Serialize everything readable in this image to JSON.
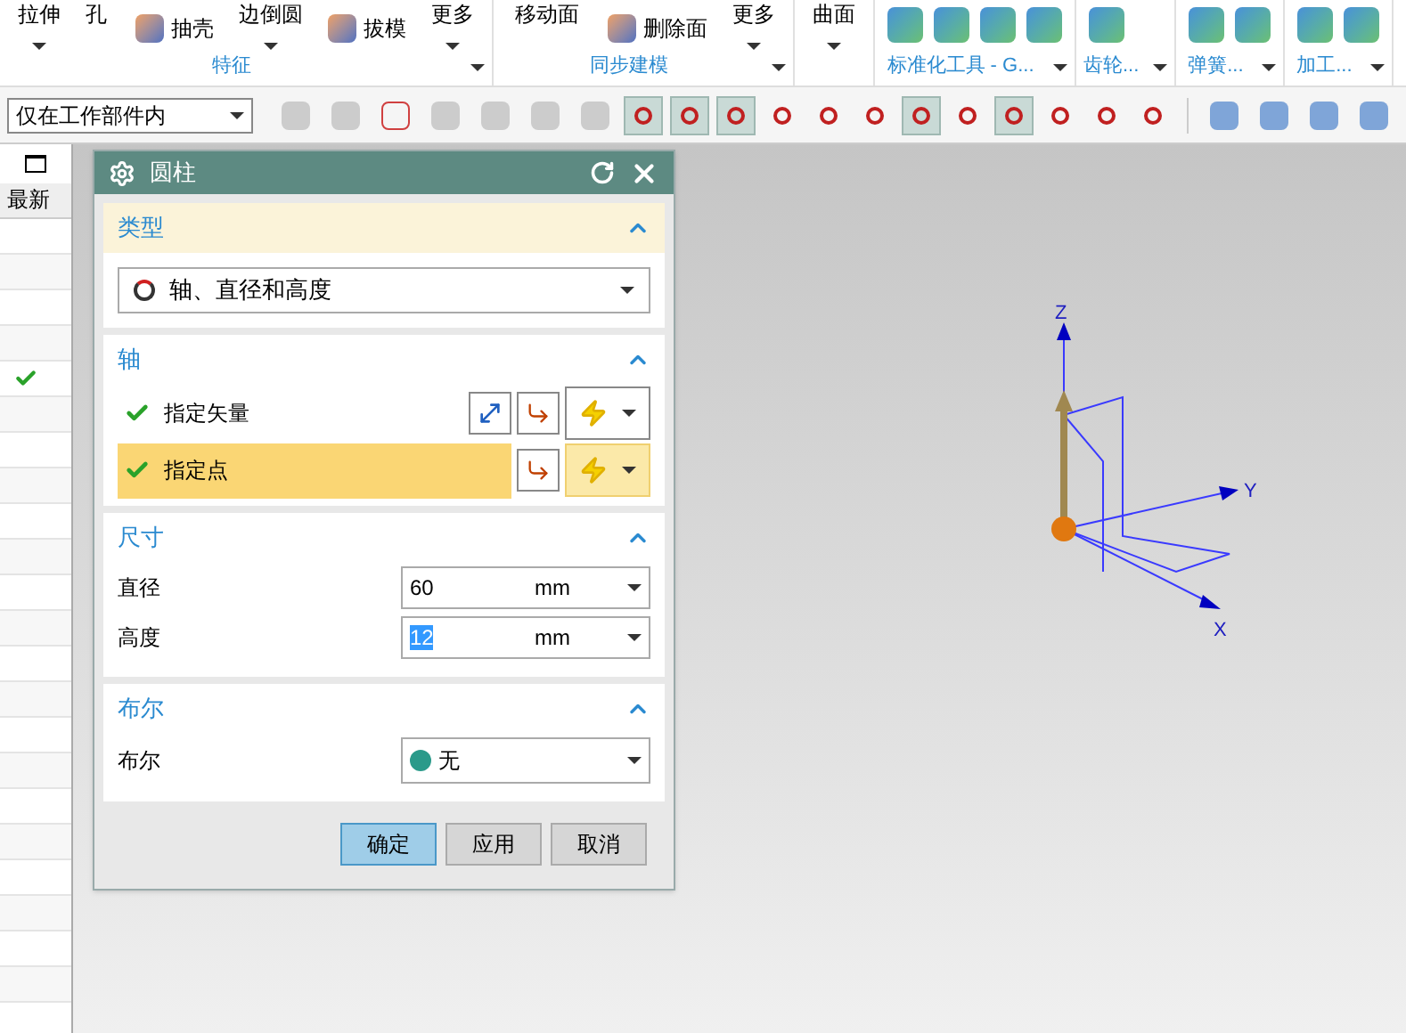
{
  "ribbon": {
    "groups": [
      {
        "label": "特征",
        "items": [
          {
            "kind": "split",
            "label": "拉伸"
          },
          {
            "kind": "label",
            "label": "孔"
          },
          {
            "kind": "icon_label",
            "label": "抽壳"
          },
          {
            "kind": "split",
            "label": "边倒圆"
          },
          {
            "kind": "icon_label",
            "label": "拔模"
          },
          {
            "kind": "split",
            "label": "更多"
          }
        ]
      },
      {
        "label": "同步建模",
        "items": [
          {
            "kind": "label",
            "label": "移动面"
          },
          {
            "kind": "icon_label",
            "label": "删除面"
          },
          {
            "kind": "split",
            "label": "更多"
          }
        ]
      },
      {
        "items": [
          {
            "kind": "split",
            "label": "曲面"
          }
        ]
      },
      {
        "label": "标准化工具 - G...",
        "items": [
          {
            "kind": "icon"
          },
          {
            "kind": "icon"
          },
          {
            "kind": "icon"
          },
          {
            "kind": "icon"
          }
        ]
      },
      {
        "label": "齿轮...",
        "items": [
          {
            "kind": "icon"
          }
        ]
      },
      {
        "label": "弹簧...",
        "items": [
          {
            "kind": "icon"
          },
          {
            "kind": "icon"
          }
        ]
      },
      {
        "label": "加工...",
        "items": [
          {
            "kind": "icon"
          },
          {
            "kind": "icon"
          }
        ]
      }
    ]
  },
  "toolbar": {
    "filter": "仅在工作部件内",
    "snap_tools": [
      {
        "selected": true
      },
      {
        "selected": true
      },
      {
        "selected": true
      },
      {
        "selected": false
      },
      {
        "selected": false
      },
      {
        "selected": false
      },
      {
        "selected": true
      },
      {
        "selected": false
      },
      {
        "selected": true
      },
      {
        "selected": false
      },
      {
        "selected": false
      },
      {
        "selected": false
      }
    ]
  },
  "history_panel": {
    "column": "最新",
    "rows": [
      {
        "checked": false
      },
      {
        "checked": false
      },
      {
        "checked": false
      },
      {
        "checked": false
      },
      {
        "checked": true
      },
      {
        "checked": false
      },
      {
        "checked": false
      },
      {
        "checked": false
      },
      {
        "checked": false
      },
      {
        "checked": false
      },
      {
        "checked": false
      },
      {
        "checked": false
      },
      {
        "checked": false
      },
      {
        "checked": false
      },
      {
        "checked": false
      },
      {
        "checked": false
      },
      {
        "checked": false
      },
      {
        "checked": false
      },
      {
        "checked": false
      },
      {
        "checked": false
      },
      {
        "checked": false
      },
      {
        "checked": false
      }
    ]
  },
  "dialog": {
    "title": "圆柱",
    "type_section": {
      "title": "类型",
      "expanded": true,
      "value": "轴、直径和高度"
    },
    "axis_section": {
      "title": "轴",
      "expanded": true,
      "rows": [
        {
          "label": "指定矢量",
          "checked": true,
          "selected": false
        },
        {
          "label": "指定点",
          "checked": true,
          "selected": true
        }
      ]
    },
    "dimensions_section": {
      "title": "尺寸",
      "expanded": true,
      "fields": [
        {
          "label": "直径",
          "value": "60",
          "unit": "mm",
          "selected": false
        },
        {
          "label": "高度",
          "value": "12",
          "unit": "mm",
          "selected": true
        }
      ]
    },
    "boolean_section": {
      "title": "布尔",
      "expanded": true,
      "label": "布尔",
      "value": "无"
    },
    "buttons": [
      {
        "label": "确定",
        "primary": true
      },
      {
        "label": "应用",
        "primary": false
      },
      {
        "label": "取消",
        "primary": false
      }
    ]
  },
  "viewport": {
    "axes": {
      "x": "X",
      "y": "Y",
      "z": "Z"
    }
  }
}
